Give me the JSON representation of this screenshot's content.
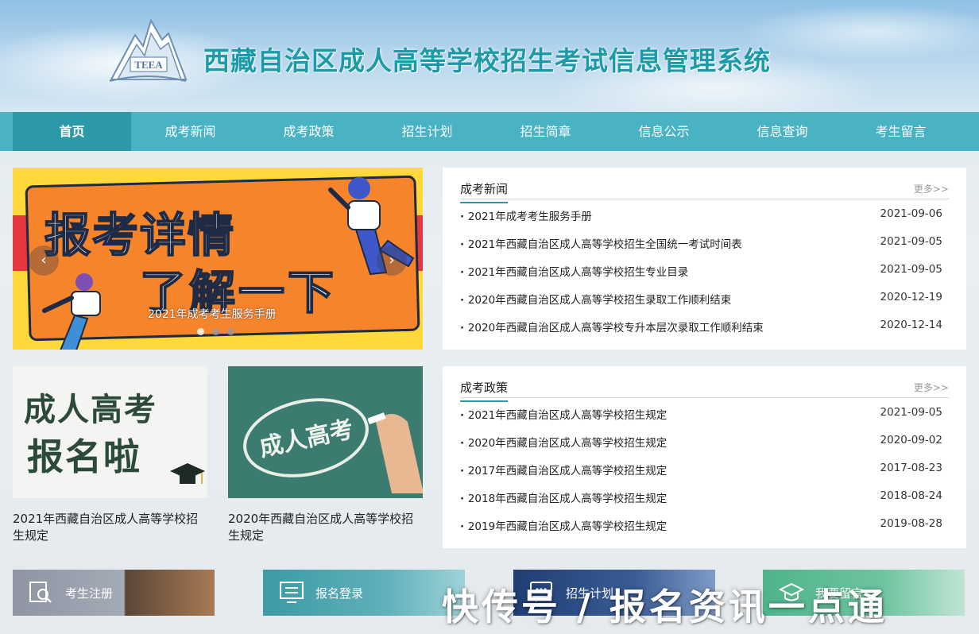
{
  "header": {
    "logo_text": "TEEA",
    "site_title": "西藏自治区成人高等学校招生考试信息管理系统"
  },
  "nav": {
    "items": [
      {
        "label": "首页",
        "active": true
      },
      {
        "label": "成考新闻",
        "active": false
      },
      {
        "label": "成考政策",
        "active": false
      },
      {
        "label": "招生计划",
        "active": false
      },
      {
        "label": "招生简章",
        "active": false
      },
      {
        "label": "信息公示",
        "active": false
      },
      {
        "label": "信息查询",
        "active": false
      },
      {
        "label": "考生留言",
        "active": false
      }
    ]
  },
  "carousel": {
    "banner_line1": "报考详情",
    "banner_line2": "了解一下",
    "caption": "2021年成考考生服务手册",
    "prev_icon": "‹",
    "next_icon": "›",
    "active_index": 0,
    "slide_count": 3
  },
  "promos": [
    {
      "image_line1": "成人高考",
      "image_line2": "报名啦",
      "title": "2021年西藏自治区成人高等学校招生规定"
    },
    {
      "image_text": "成人高考",
      "title": "2020年西藏自治区成人高等学校招生规定"
    }
  ],
  "news_panel": {
    "title": "成考新闻",
    "more": "更多>>",
    "items": [
      {
        "title": "2021年成考考生服务手册",
        "date": "2021-09-06"
      },
      {
        "title": "2021年西藏自治区成人高等学校招生全国统一考试时间表",
        "date": "2021-09-05"
      },
      {
        "title": "2021年西藏自治区成人高等学校招生专业目录",
        "date": "2021-09-05"
      },
      {
        "title": "2020年西藏自治区成人高等学校招生录取工作顺利结束",
        "date": "2020-12-19"
      },
      {
        "title": "2020年西藏自治区成人高等学校专升本层次录取工作顺利结束",
        "date": "2020-12-14"
      }
    ]
  },
  "policy_panel": {
    "title": "成考政策",
    "more": "更多>>",
    "items": [
      {
        "title": "2021年西藏自治区成人高等学校招生规定",
        "date": "2021-09-05"
      },
      {
        "title": "2020年西藏自治区成人高等学校招生规定",
        "date": "2020-09-02"
      },
      {
        "title": "2017年西藏自治区成人高等学校招生规定",
        "date": "2017-08-23"
      },
      {
        "title": "2018年西藏自治区成人高等学校招生规定",
        "date": "2018-08-24"
      },
      {
        "title": "2019年西藏自治区成人高等学校招生规定",
        "date": "2019-08-28"
      }
    ]
  },
  "quick_links": [
    {
      "label": "考生注册",
      "icon": "search-doc-icon"
    },
    {
      "label": "报名登录",
      "icon": "monitor-icon"
    },
    {
      "label": "招生计划",
      "icon": "chat-icon"
    },
    {
      "label": "我要留言",
      "icon": "grad-cap-icon"
    }
  ],
  "watermark": "快传号 / 报名资讯一点通"
}
